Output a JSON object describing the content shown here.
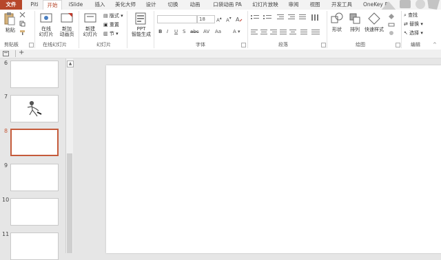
{
  "tabs": {
    "file": "文件",
    "items": [
      "Piti",
      "开始",
      "iSlide",
      "插入",
      "美化大师",
      "设计",
      "切换",
      "动画",
      "口袋动画 PA",
      "幻灯片放映",
      "审阅",
      "视图",
      "开发工具",
      "OneKey 8"
    ],
    "active": "开始"
  },
  "ribbon": {
    "clipboard": {
      "paste": "粘贴",
      "label": "剪贴板"
    },
    "online": {
      "online_slide": "在线\n幻灯片",
      "new_anim": "新加\n动画页",
      "label": "在线幻灯片"
    },
    "slides": {
      "new_slide": "新建\n幻灯片",
      "layout": "版式",
      "reset": "重置",
      "section": "节",
      "label": "幻灯片"
    },
    "ppt": {
      "text": "PPT\n智能生成"
    },
    "font": {
      "size": "18",
      "label": "字体"
    },
    "paragraph": {
      "label": "段落"
    },
    "drawing": {
      "shape": "形状",
      "arrange": "排列",
      "quick_style": "快速样式",
      "label": "绘图"
    },
    "editing": {
      "find": "查找",
      "replace": "替换",
      "select": "选择",
      "label": "编辑"
    }
  },
  "slides": [
    {
      "num": "6",
      "has_content": false
    },
    {
      "num": "7",
      "has_content": true
    },
    {
      "num": "8",
      "has_content": false,
      "selected": true
    },
    {
      "num": "9",
      "has_content": false
    },
    {
      "num": "10",
      "has_content": false
    },
    {
      "num": "11",
      "has_content": false
    }
  ],
  "quickbar": {
    "add": "+"
  },
  "colors": {
    "accent": "#b7472a",
    "selected_border": "#c55a3a"
  }
}
